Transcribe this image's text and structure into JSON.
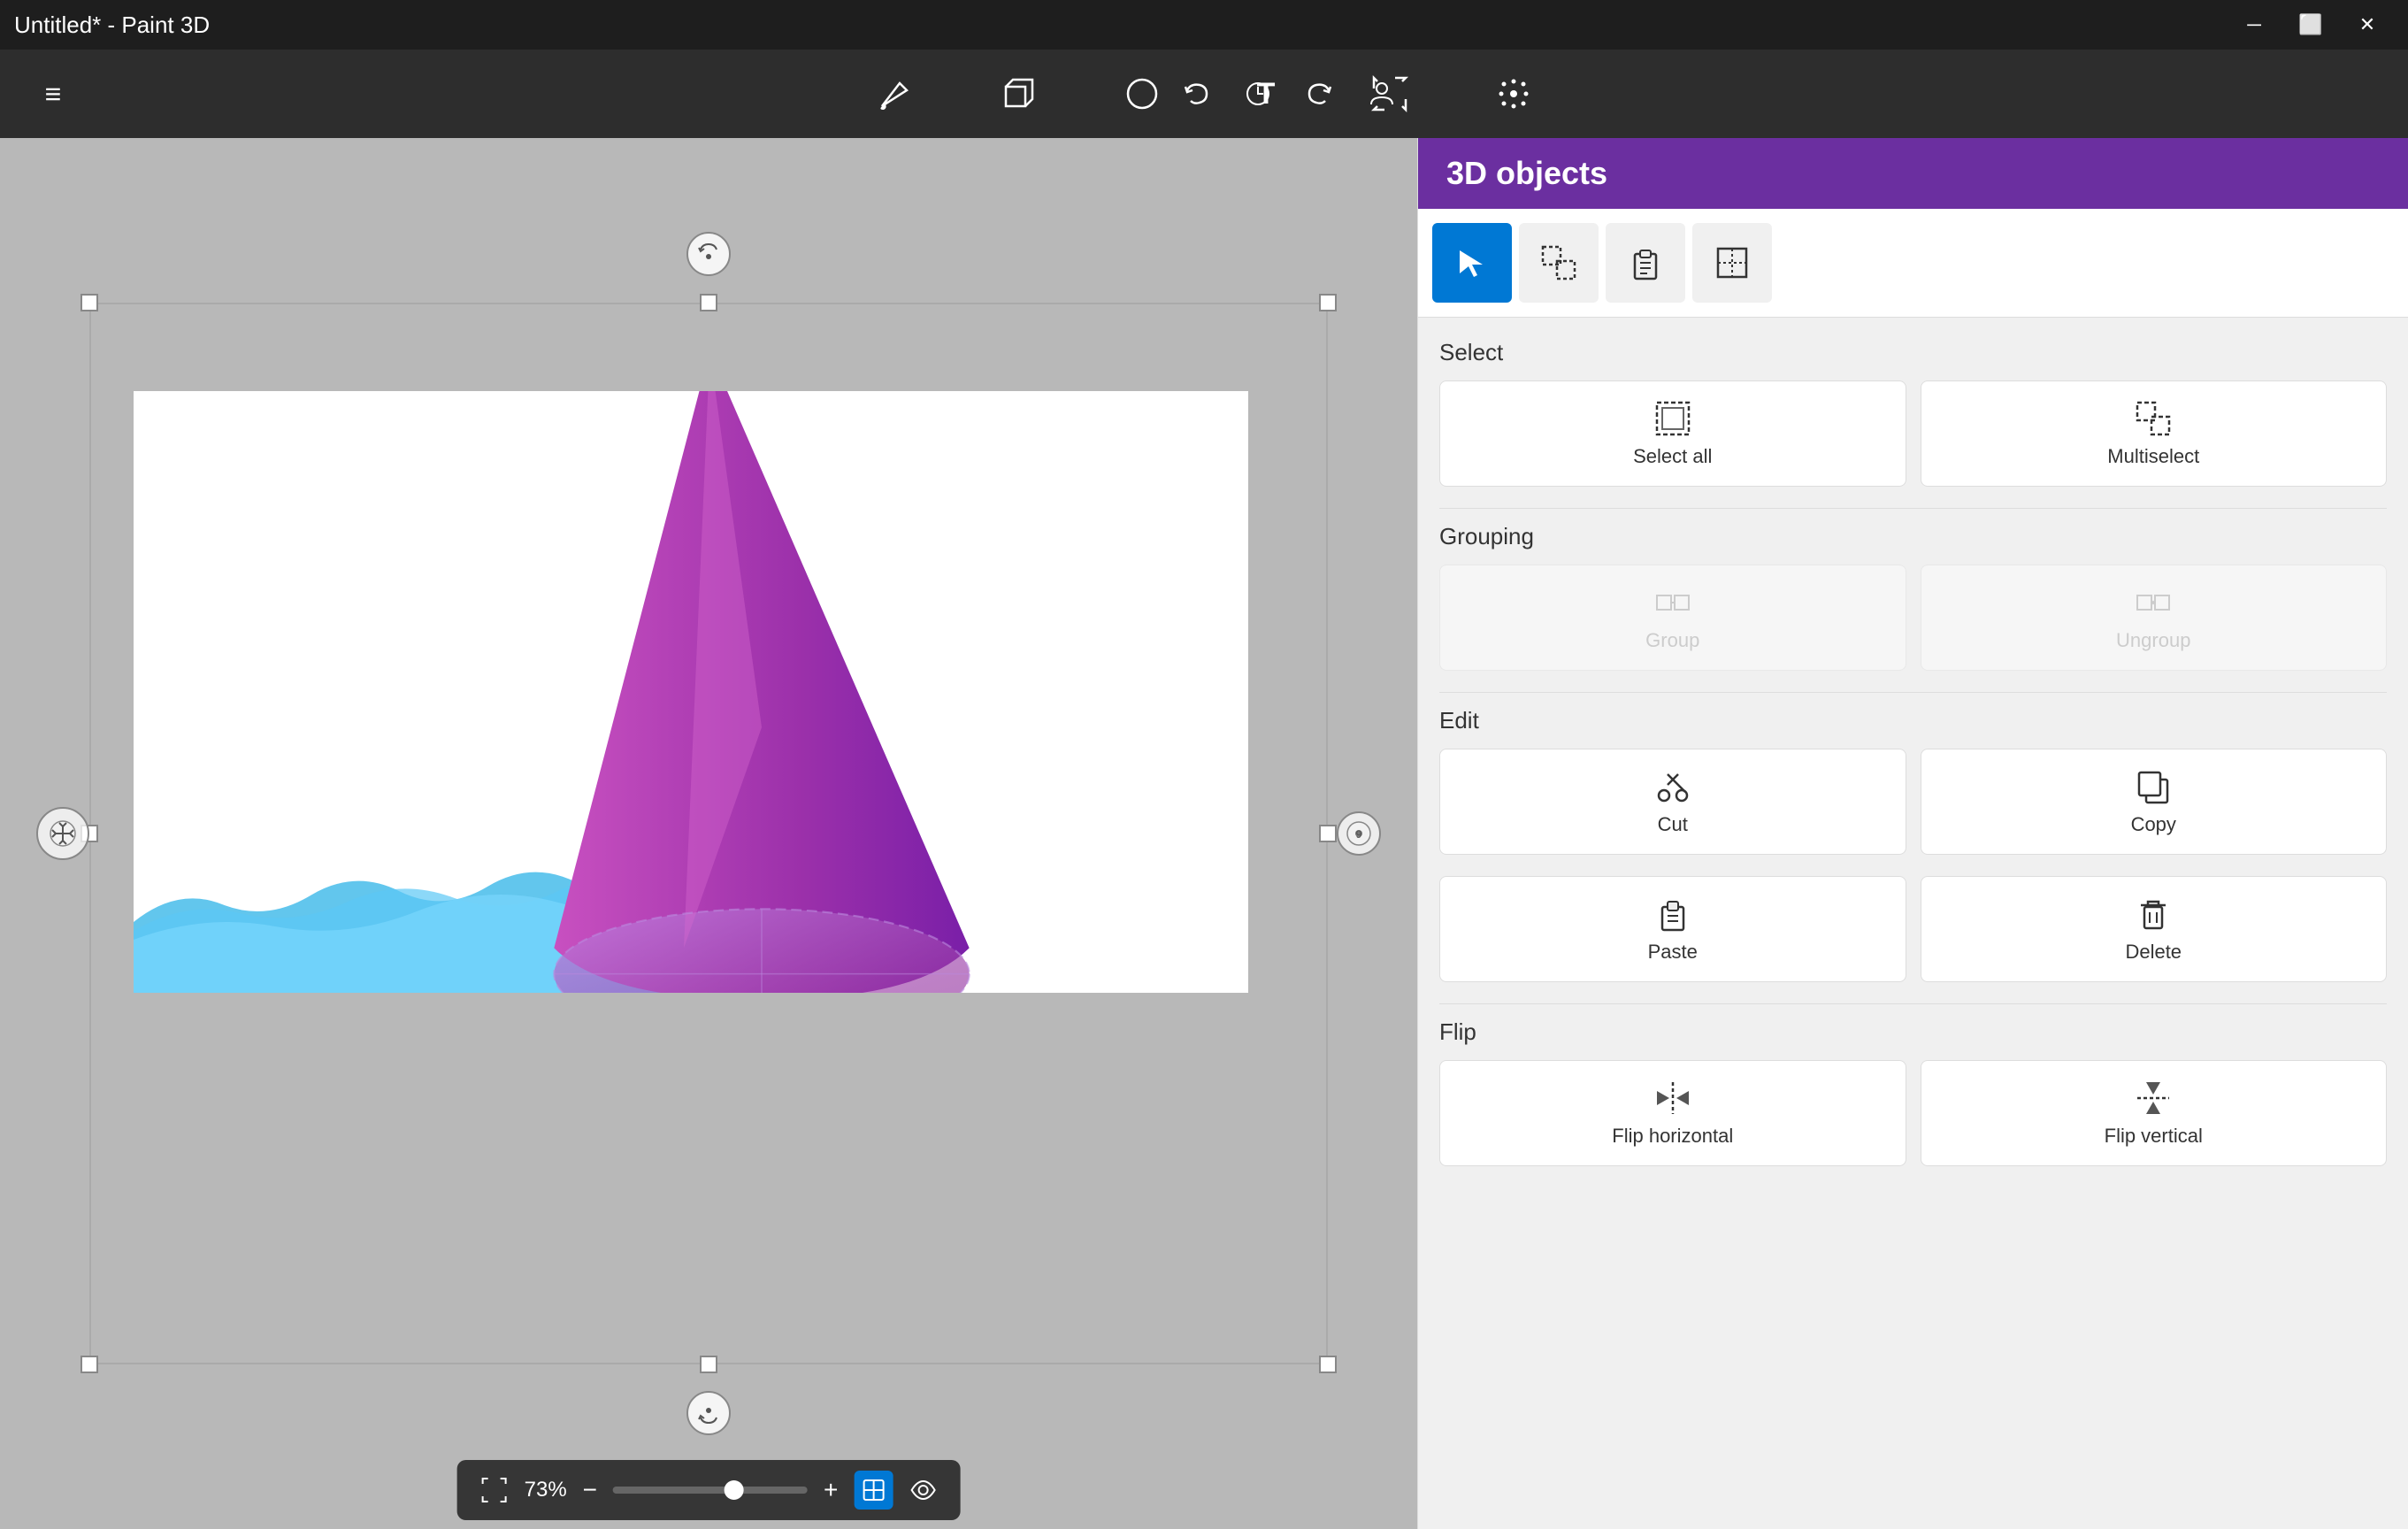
{
  "titlebar": {
    "title": "Untitled* - Paint 3D",
    "controls": {
      "minimize": "─",
      "maximize": "⬜",
      "close": "✕"
    }
  },
  "toolbar": {
    "tools": [
      {
        "name": "hamburger-menu",
        "icon": "≡",
        "label": "Menu"
      },
      {
        "name": "brushes-tool",
        "icon": "✏",
        "label": "Brushes"
      },
      {
        "name": "3d-shapes-tool",
        "icon": "◈",
        "label": "3D shapes"
      },
      {
        "name": "2d-shapes-tool",
        "icon": "○",
        "label": "2D shapes"
      },
      {
        "name": "text-tool",
        "icon": "T",
        "label": "Text"
      },
      {
        "name": "canvas-tool",
        "icon": "⤢",
        "label": "Canvas"
      },
      {
        "name": "effects-tool",
        "icon": "✦",
        "label": "Effects"
      }
    ],
    "right_tools": [
      {
        "name": "undo-btn",
        "icon": "↩"
      },
      {
        "name": "history-btn",
        "icon": "🕐"
      },
      {
        "name": "redo-btn",
        "icon": "↪"
      },
      {
        "name": "people-btn",
        "icon": "👤"
      }
    ]
  },
  "canvas": {
    "zoom_percent": "73%",
    "zoom_minus": "−",
    "zoom_plus": "+"
  },
  "right_panel": {
    "title": "3D objects",
    "tools": [
      {
        "name": "select-tool",
        "icon": "↖",
        "active": true
      },
      {
        "name": "multiselect-tool",
        "icon": "⊞",
        "active": false
      },
      {
        "name": "paste-special-tool",
        "icon": "📋",
        "active": false
      },
      {
        "name": "transform-tool",
        "icon": "⊡",
        "active": false
      }
    ],
    "sections": {
      "select": {
        "label": "Select",
        "buttons": [
          {
            "name": "select-all-btn",
            "icon": "⊞",
            "label": "Select all",
            "disabled": false
          },
          {
            "name": "multiselect-btn",
            "icon": "⊡",
            "label": "Multiselect",
            "disabled": false
          }
        ]
      },
      "grouping": {
        "label": "Grouping",
        "buttons": [
          {
            "name": "group-btn",
            "icon": "⊞",
            "label": "Group",
            "disabled": true
          },
          {
            "name": "ungroup-btn",
            "icon": "⊟",
            "label": "Ungroup",
            "disabled": true
          }
        ]
      },
      "edit": {
        "label": "Edit",
        "buttons": [
          {
            "name": "cut-btn",
            "icon": "✂",
            "label": "Cut",
            "disabled": false
          },
          {
            "name": "copy-btn",
            "icon": "📄",
            "label": "Copy",
            "disabled": false
          },
          {
            "name": "paste-btn",
            "icon": "📋",
            "label": "Paste",
            "disabled": false
          },
          {
            "name": "delete-btn",
            "icon": "🗑",
            "label": "Delete",
            "disabled": false
          }
        ]
      },
      "flip": {
        "label": "Flip",
        "buttons": [
          {
            "name": "flip-horizontal-btn",
            "icon": "⇔",
            "label": "Flip horizontal",
            "disabled": false
          },
          {
            "name": "flip-vertical-btn",
            "icon": "⇕",
            "label": "Flip vertical",
            "disabled": false
          }
        ]
      }
    }
  },
  "help": {
    "label": "?"
  }
}
